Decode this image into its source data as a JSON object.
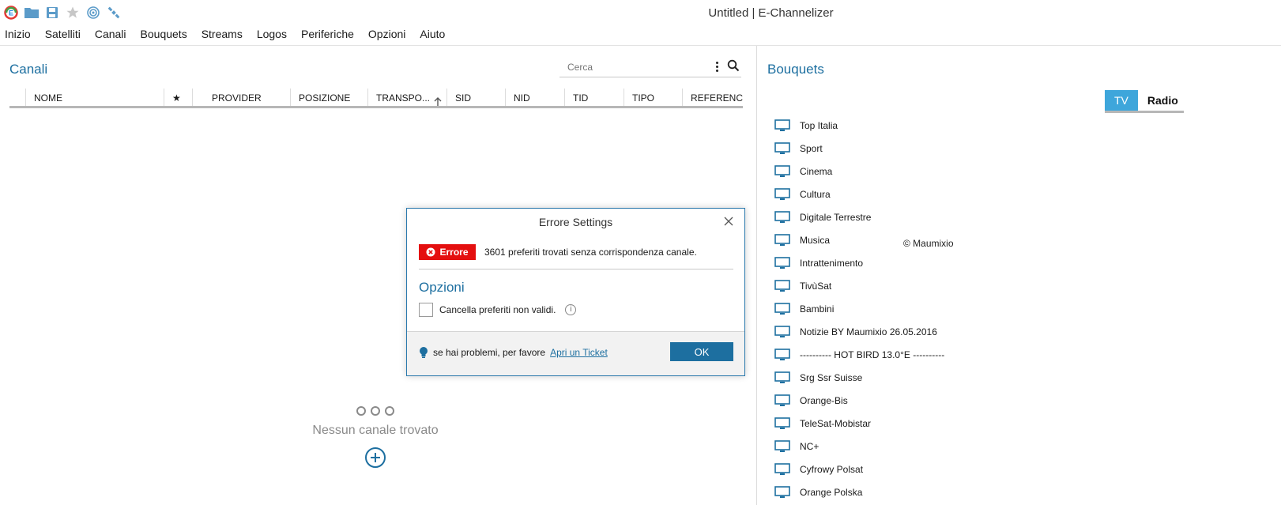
{
  "app": {
    "title": "Untitled | E-Channelizer"
  },
  "toolbar_icons": [
    "app-logo-icon",
    "open-folder-icon",
    "save-icon",
    "star-icon",
    "receiver-icon",
    "satellite-icon"
  ],
  "menu": [
    "Inizio",
    "Satelliti",
    "Canali",
    "Bouquets",
    "Streams",
    "Logos",
    "Periferiche",
    "Opzioni",
    "Aiuto"
  ],
  "channels": {
    "title": "Canali",
    "search_placeholder": "Cerca",
    "columns": [
      "NOME",
      "★",
      "PROVIDER",
      "POSIZIONE",
      "TRANSPO...",
      "SID",
      "NID",
      "TID",
      "TIPO",
      "REFERENC"
    ],
    "empty_text": "Nessun canale trovato"
  },
  "bouquets": {
    "title": "Bouquets",
    "tabs": [
      "TV",
      "Radio"
    ],
    "active_tab": "TV",
    "items": [
      "Top Italia",
      "Sport",
      "Cinema",
      "Cultura",
      "Digitale Terrestre",
      "Musica",
      "Intrattenimento",
      "TivùSat",
      "Bambini",
      "Notizie BY  Maumixio 26.05.2016",
      "---------- HOT BIRD 13.0°E ----------",
      "Srg Ssr Suisse",
      "Orange-Bis",
      "TeleSat-Mobistar",
      "NC+",
      "Cyfrowy Polsat",
      "Orange Polska"
    ],
    "watermark": "© Maumixio"
  },
  "dialog": {
    "title": "Errore Settings",
    "badge": "Errore",
    "message": "3601 preferiti trovati senza corrispondenza canale.",
    "section": "Opzioni",
    "checkbox_label": "Cancella preferiti non validi.",
    "checkbox_checked": false,
    "footer_text": "se hai problemi, per favore",
    "footer_link": "Apri un Ticket",
    "ok_label": "OK"
  },
  "colors": {
    "accent": "#1d6fa0",
    "tab_active": "#3ea6db",
    "error": "#e40f0f"
  }
}
